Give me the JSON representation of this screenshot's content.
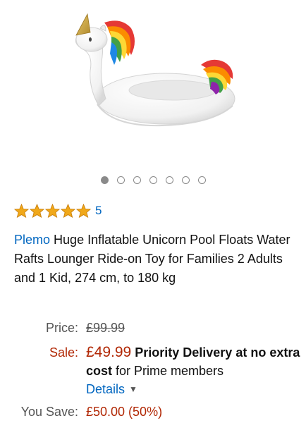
{
  "product": {
    "image_alt": "inflatable-unicorn-pool-float",
    "carousel": {
      "count": 7,
      "active_index": 0
    },
    "rating": {
      "stars": 5,
      "count_label": "5"
    },
    "brand": "Plemo",
    "title": "Huge Inflatable Unicorn Pool Floats Water Rafts Lounger Ride-on Toy for Families 2 Adults and 1 Kid, 274 cm, to 180 kg"
  },
  "pricing": {
    "price_label": "Price:",
    "list_price": "£99.99",
    "sale_label": "Sale:",
    "sale_price": "£49.99",
    "delivery_bold": "Priority Delivery at no extra cost",
    "delivery_rest": " for Prime members",
    "details_label": "Details",
    "save_label": "You Save:",
    "savings": "£50.00 (50%)"
  },
  "colors": {
    "link": "#0066c0",
    "sale": "#b12704",
    "star": "#f0a81a"
  }
}
